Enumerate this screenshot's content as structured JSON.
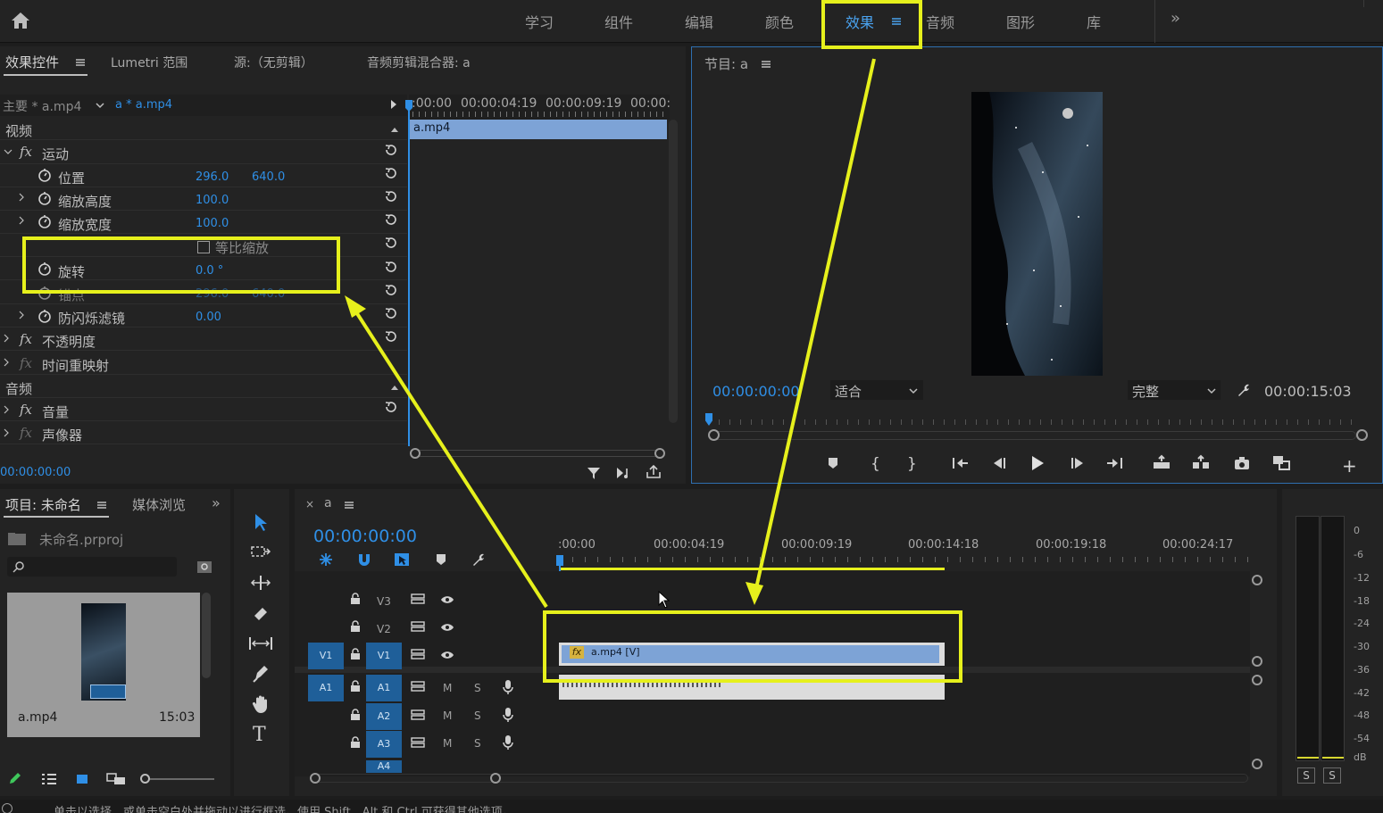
{
  "workspace_tabs": [
    "学习",
    "组件",
    "编辑",
    "颜色",
    "效果",
    "音频",
    "图形",
    "库"
  ],
  "workspace_active": "效果",
  "effect_controls": {
    "tabs": [
      "效果控件",
      "Lumetri 范围",
      "源:（无剪辑）",
      "音频剪辑混合器: a"
    ],
    "clip_master": "主要 * a.mp4",
    "clip_selected": "a * a.mp4",
    "timeline_ticks": [
      ":00:00",
      "00:00:04:19",
      "00:00:09:19",
      "00:00:"
    ],
    "clip_label": "a.mp4",
    "section_video": "视频",
    "motion": "运动",
    "position_label": "位置",
    "position_x": "296.0",
    "position_y": "640.0",
    "scale_height_label": "缩放高度",
    "scale_height": "100.0",
    "scale_width_label": "缩放宽度",
    "scale_width": "100.0",
    "uniform_scale": "等比缩放",
    "rotation_label": "旋转",
    "rotation": "0.0 °",
    "anchor_label": "锚点",
    "anchor_x": "296.0",
    "anchor_y": "640.0",
    "flicker_label": "防闪烁滤镜",
    "flicker": "0.00",
    "opacity": "不透明度",
    "time_remap": "时间重映射",
    "section_audio": "音频",
    "volume": "音量",
    "panner": "声像器",
    "timecode": "00:00:00:00"
  },
  "program_monitor": {
    "title": "节目: a",
    "timecode": "00:00:00:00",
    "fit": "适合",
    "quality": "完整",
    "duration": "00:00:15:03"
  },
  "project": {
    "tabs": [
      "项目: 未命名",
      "媒体浏览"
    ],
    "file": "未命名.prproj",
    "clip_name": "a.mp4",
    "clip_duration": "15:03"
  },
  "sequence": {
    "name": "a",
    "timecode": "00:00:00:00",
    "ticks": [
      ":00:00",
      "00:00:04:19",
      "00:00:09:19",
      "00:00:14:18",
      "00:00:19:18",
      "00:00:24:17"
    ],
    "video_tracks": [
      "V3",
      "V2",
      "V1"
    ],
    "audio_tracks": [
      "A1",
      "A2",
      "A3",
      "A4"
    ],
    "source_v": "V1",
    "source_a": "A1",
    "m_label": "M",
    "s_label": "S",
    "clip": "a.mp4 [V]"
  },
  "meter": {
    "scale": [
      "0",
      "-6",
      "-12",
      "-18",
      "-24",
      "-30",
      "-36",
      "-42",
      "-48",
      "-54",
      "dB"
    ],
    "solo": [
      "S",
      "S"
    ]
  },
  "status_bar": "单击以选择，或单击空白处并拖动以进行框选。使用 Shift、Alt 和 Ctrl 可获得其他选项。",
  "colors": {
    "accent": "#2f8fe6",
    "highlight": "#e6f01c",
    "clip": "#7da3d6"
  }
}
